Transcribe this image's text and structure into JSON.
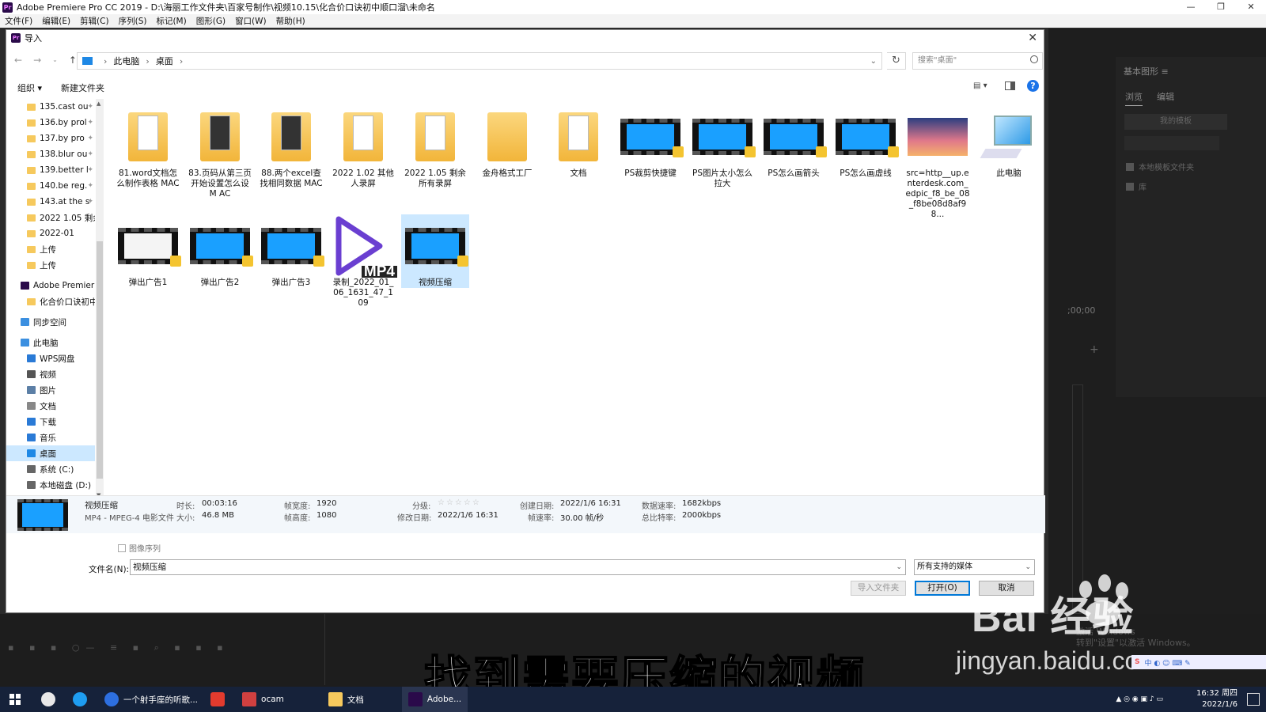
{
  "app": {
    "title": "Adobe Premiere Pro CC 2019 - D:\\海丽工作文件夹\\百家号制作\\视频10.15\\化合价口诀初中顺口溜\\未命名",
    "menu": [
      "文件(F)",
      "编辑(E)",
      "剪辑(C)",
      "序列(S)",
      "标记(M)",
      "图形(G)",
      "窗口(W)",
      "帮助(H)"
    ],
    "right_panel": {
      "title": "基本图形 ≡",
      "tabs": [
        "浏览",
        "编辑"
      ],
      "templates": "我的模板",
      "check1": "本地模板文件夹",
      "check2": "库",
      "timecode": ";00;00"
    }
  },
  "dialog": {
    "title": "导入",
    "breadcrumb": [
      "此电脑",
      "桌面"
    ],
    "search_placeholder": "搜索\"桌面\"",
    "toolbar": {
      "organize": "组织 ▾",
      "new_folder": "新建文件夹"
    },
    "sidebar": [
      {
        "label": "135.cast ou",
        "type": "folder",
        "pinned": true
      },
      {
        "label": "136.by prol",
        "type": "folder",
        "pinned": true
      },
      {
        "label": "137.by pro",
        "type": "folder",
        "pinned": true
      },
      {
        "label": "138.blur ou",
        "type": "folder",
        "pinned": true
      },
      {
        "label": "139.better l",
        "type": "folder",
        "pinned": true
      },
      {
        "label": "140.be reg.",
        "type": "folder",
        "pinned": true
      },
      {
        "label": "143.at the s",
        "type": "folder",
        "pinned": true
      },
      {
        "label": "2022 1.05 剩余",
        "type": "folder",
        "pinned": false
      },
      {
        "label": "2022-01",
        "type": "folder",
        "pinned": false
      },
      {
        "label": "上传",
        "type": "folder",
        "pinned": false
      },
      {
        "label": "上传",
        "type": "folder",
        "pinned": false
      },
      {
        "label": "Adobe Premier",
        "type": "premiere",
        "top": true
      },
      {
        "label": "化合价口诀初中",
        "type": "folder",
        "pinned": false
      },
      {
        "label": "同步空间",
        "type": "sync",
        "top": true
      },
      {
        "label": "此电脑",
        "type": "pc",
        "top": true
      },
      {
        "label": "WPS网盘",
        "type": "cloud"
      },
      {
        "label": "视频",
        "type": "video"
      },
      {
        "label": "图片",
        "type": "picture"
      },
      {
        "label": "文档",
        "type": "doc"
      },
      {
        "label": "下载",
        "type": "download"
      },
      {
        "label": "音乐",
        "type": "music"
      },
      {
        "label": "桌面",
        "type": "desktop",
        "selected": true
      },
      {
        "label": "系统 (C:)",
        "type": "drive"
      },
      {
        "label": "本地磁盘 (D:)",
        "type": "drive"
      },
      {
        "label": "网络",
        "type": "network",
        "top": true
      }
    ],
    "files": [
      {
        "name": "81.word文档怎么制作表格 MAC",
        "kind": "folder-doc"
      },
      {
        "name": "83.页码从第三页开始设置怎么设 M AC",
        "kind": "folder-dark"
      },
      {
        "name": "88.两个excel查找相同数据 MAC",
        "kind": "folder-dark"
      },
      {
        "name": "2022 1.02 其他人录屏",
        "kind": "folder"
      },
      {
        "name": "2022 1.05 剩余所有录屏",
        "kind": "folder"
      },
      {
        "name": "金舟格式工厂",
        "kind": "folder-plain"
      },
      {
        "name": "文档",
        "kind": "folder-doc"
      },
      {
        "name": "PS裁剪快捷键",
        "kind": "video"
      },
      {
        "name": "PS图片太小怎么拉大",
        "kind": "video"
      },
      {
        "name": "PS怎么画箭头",
        "kind": "video"
      },
      {
        "name": "PS怎么画虚线",
        "kind": "video"
      },
      {
        "name": "src=http__up.enterdesk.com_edpic_f8_be_08_f8be08d8af98...",
        "kind": "photo"
      },
      {
        "name": "此电脑",
        "kind": "computer"
      },
      {
        "name": "弹出广告1",
        "kind": "video-white"
      },
      {
        "name": "弹出广告2",
        "kind": "video"
      },
      {
        "name": "弹出广告3",
        "kind": "video"
      },
      {
        "name": "录制_2022_01_06_1631_47_109",
        "kind": "mp4"
      },
      {
        "name": "视频压缩",
        "kind": "video",
        "selected": true
      }
    ],
    "mp4_tag": "MP4",
    "details": {
      "name": "视频压缩",
      "type": "MP4 - MPEG-4 电影文件",
      "duration_label": "时长:",
      "duration": "00:03:16",
      "size_label": "大小:",
      "size": "46.8 MB",
      "width_label": "帧宽度:",
      "width": "1920",
      "height_label": "帧高度:",
      "height": "1080",
      "rating_label": "分级:",
      "rating": "☆☆☆☆☆",
      "modified_label": "修改日期:",
      "modified": "2022/1/6 16:31",
      "created_label": "创建日期:",
      "created": "2022/1/6 16:31",
      "fps_label": "帧速率:",
      "fps": "30.00 帧/秒",
      "datarate_label": "数据速率:",
      "datarate": "1682kbps",
      "bitrate_label": "总比特率:",
      "bitrate": "2000kbps"
    },
    "image_sequence": "图像序列",
    "filename_label": "文件名(N):",
    "filename_value": "视频压缩",
    "filetype": "所有支持的媒体",
    "buttons": {
      "import_folder": "导入文件夹",
      "open": "打开(O)",
      "cancel": "取消"
    }
  },
  "overlay": {
    "subtitle": "找到需要压缩的视频",
    "watermark_brand": "Bai 经验",
    "watermark_url": "jingyan.baidu.com",
    "activate1": "激活 Windows",
    "activate2": "转到\"设置\"以激活 Windows。"
  },
  "taskbar": {
    "items": [
      "一个射手座的听歌...",
      "ocam",
      "文档",
      "Adobe..."
    ],
    "time": "16:32 周四",
    "date": "2022/1/6"
  }
}
